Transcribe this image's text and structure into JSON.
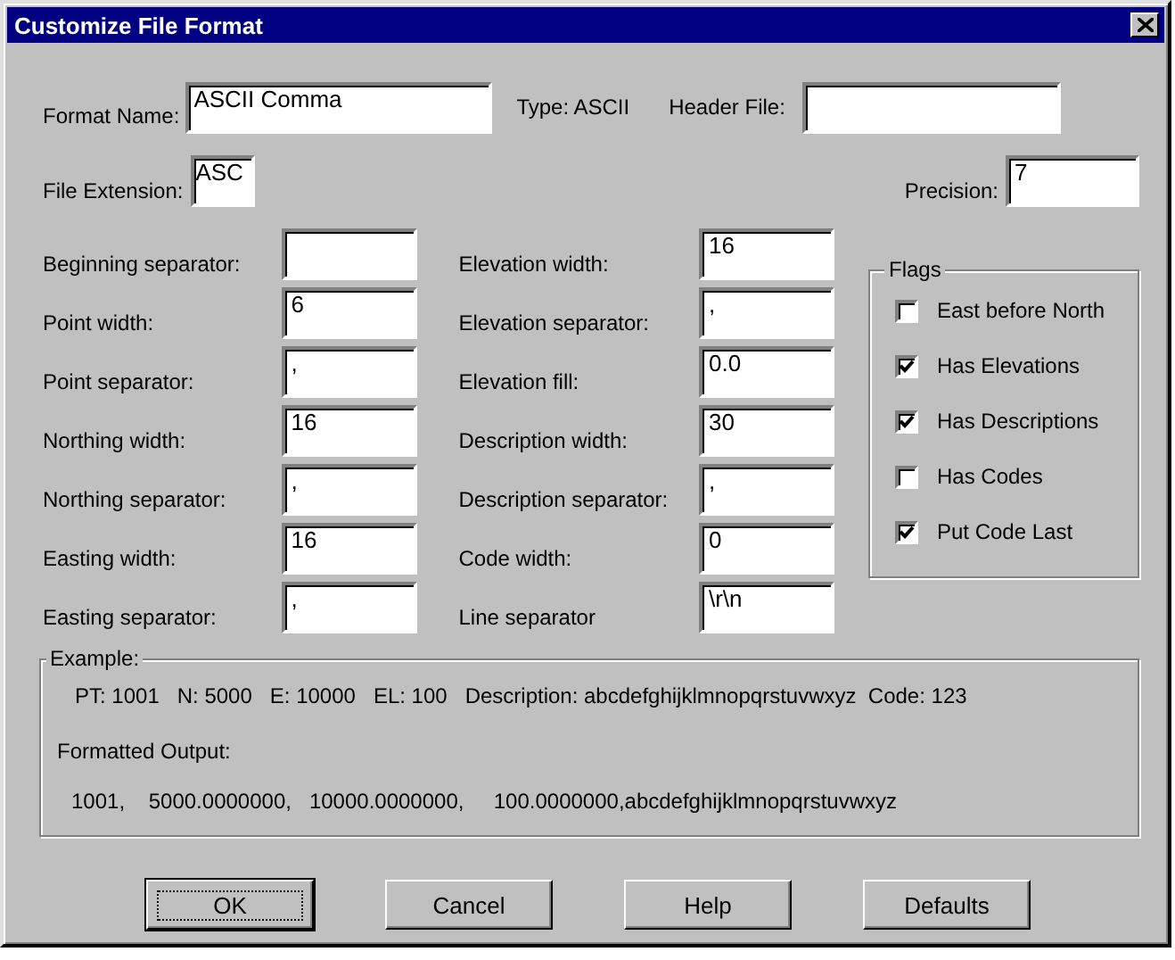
{
  "window": {
    "title": "Customize File Format"
  },
  "format_name": {
    "label": "Format Name:",
    "value": "ASCII Comma"
  },
  "type_text": "Type: ASCII",
  "header_file": {
    "label": "Header File:"
  },
  "file_extension": {
    "label": "File Extension:",
    "value": "ASC"
  },
  "precision": {
    "label": "Precision:",
    "value": "7"
  },
  "left_fields": [
    {
      "label": "Beginning separator:"
    },
    {
      "label": "Point width:",
      "value": "6"
    },
    {
      "label": "Point separator:",
      "value": ","
    },
    {
      "label": "Northing width:",
      "value": "16"
    },
    {
      "label": "Northing separator:",
      "value": ","
    },
    {
      "label": "Easting width:",
      "value": "16"
    },
    {
      "label": "Easting separator:",
      "value": ","
    }
  ],
  "middle_fields": [
    {
      "label": "Elevation width:",
      "value": "16"
    },
    {
      "label": "Elevation separator:",
      "value": ","
    },
    {
      "label": "Elevation fill:",
      "value": "0.0"
    },
    {
      "label": "Description width:",
      "value": "30"
    },
    {
      "label": "Description separator:",
      "value": ","
    },
    {
      "label": "Code width:",
      "value": "0"
    },
    {
      "label": "Line separator",
      "value": "\\r\\n"
    }
  ],
  "flags": {
    "title": "Flags",
    "items": [
      {
        "label": "East before North",
        "checked": false
      },
      {
        "label": "Has Elevations",
        "checked": true
      },
      {
        "label": "Has Descriptions",
        "checked": true
      },
      {
        "label": "Has Codes",
        "checked": false
      },
      {
        "label": "Put Code Last",
        "checked": true
      }
    ]
  },
  "example": {
    "title": "Example:",
    "record": "PT: 1001   N: 5000   E: 10000   EL: 100   Description: abcdefghijklmnopqrstuvwxyz  Code: 123",
    "output_label": "Formatted Output:",
    "output": "1001,    5000.0000000,   10000.0000000,     100.0000000,abcdefghijklmnopqrstuvwxyz"
  },
  "buttons": [
    {
      "label": "OK",
      "default": true
    },
    {
      "label": "Cancel",
      "default": false
    },
    {
      "label": "Help",
      "default": false
    },
    {
      "label": "Defaults",
      "default": false
    }
  ]
}
